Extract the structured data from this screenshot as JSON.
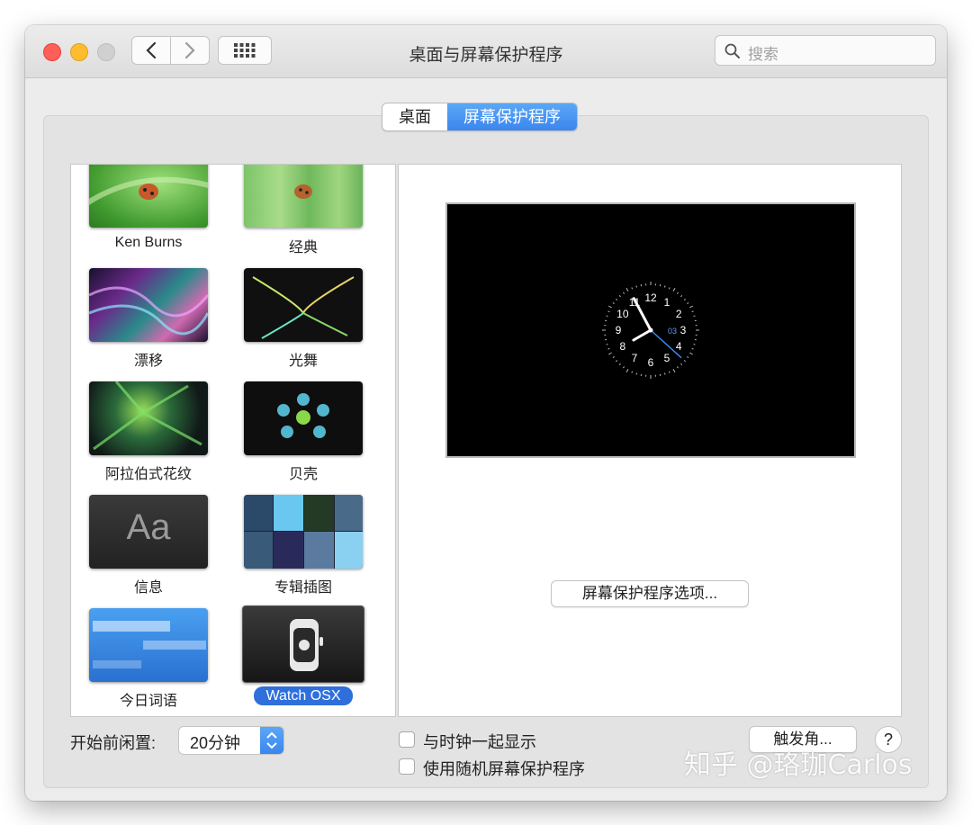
{
  "window": {
    "title": "桌面与屏幕保护程序"
  },
  "search": {
    "placeholder": "搜索"
  },
  "tabs": [
    {
      "label": "桌面"
    },
    {
      "label": "屏幕保护程序"
    }
  ],
  "screensavers": [
    {
      "label": "Ken Burns",
      "thumb": "ken-burns-thumbnail"
    },
    {
      "label": "经典",
      "thumb": "classic-thumbnail"
    },
    {
      "label": "漂移",
      "thumb": "drift-thumbnail"
    },
    {
      "label": "光舞",
      "thumb": "flurry-thumbnail"
    },
    {
      "label": "阿拉伯式花纹",
      "thumb": "arabesque-thumbnail"
    },
    {
      "label": "贝壳",
      "thumb": "shell-thumbnail"
    },
    {
      "label": "信息",
      "thumb": "message-thumbnail",
      "thumb_text": "Aa"
    },
    {
      "label": "专辑插图",
      "thumb": "album-artwork-thumbnail"
    },
    {
      "label": "今日词语",
      "thumb": "word-of-the-day-thumbnail"
    },
    {
      "label": "Watch OSX",
      "thumb": "watch-osx-thumbnail",
      "selected": true
    }
  ],
  "preview": {
    "clock_numbers": [
      "12",
      "1",
      "2",
      "3",
      "4",
      "5",
      "6",
      "7",
      "8",
      "9",
      "10",
      "11"
    ],
    "clock_date": "03"
  },
  "options_button": "屏幕保护程序选项...",
  "idle": {
    "label": "开始前闲置:",
    "value": "20分钟"
  },
  "checkboxes": [
    {
      "label": "与时钟一起显示",
      "checked": false
    },
    {
      "label": "使用随机屏幕保护程序",
      "checked": false
    }
  ],
  "hot_corners_button": "触发角...",
  "help_button": "?",
  "watermark": "知乎 @珞珈Carlos",
  "colors": {
    "accent": "#3a86ee",
    "selection": "#2f6fdc"
  }
}
